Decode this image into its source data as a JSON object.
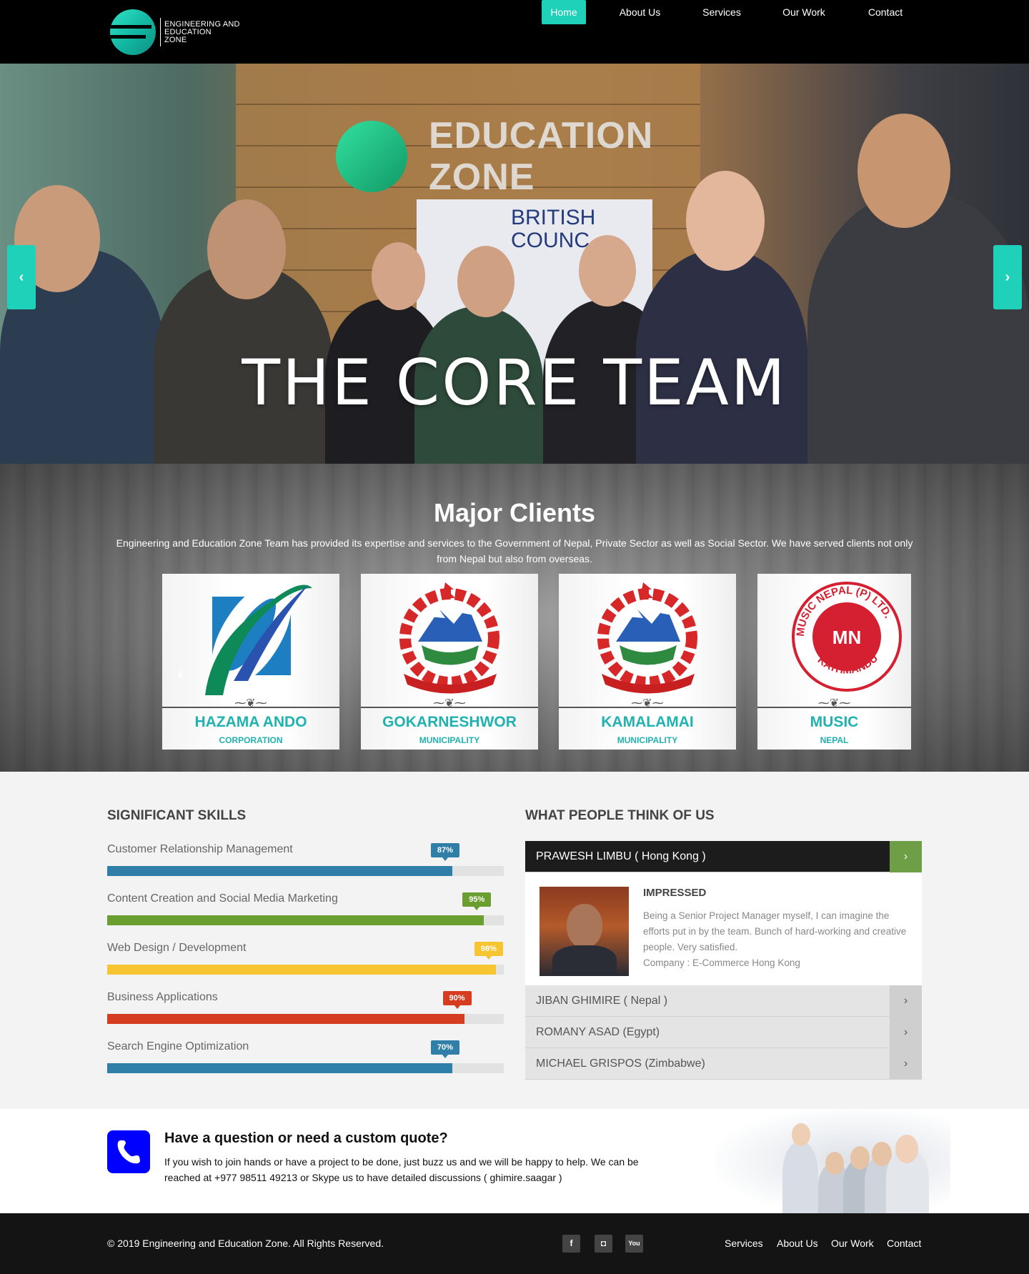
{
  "header": {
    "logo_text": [
      "ENGINEERING AND",
      "EDUCATION",
      "ZONE"
    ],
    "nav": [
      "Home",
      "About Us",
      "Services",
      "Our Work",
      "Contact"
    ],
    "accent": "#1fd1b9"
  },
  "hero": {
    "title": "THE CORE TEAM",
    "sign_text": [
      "EDUCATION",
      "ZONE"
    ],
    "banner_text": [
      "BRITISH",
      "COUNC"
    ],
    "prev_icon": "chevron-left-icon",
    "next_icon": "chevron-right-icon"
  },
  "clients": {
    "title": "Major Clients",
    "description": "Engineering and Education Zone Team has provided its expertise and services to the Government of Nepal, Private Sector as well as Social Sector. We have served clients not only from Nepal but also from overseas.",
    "items": [
      {
        "name": "HAZAMA ANDO",
        "sub": "CORPORATION"
      },
      {
        "name": "GOKARNESHWOR",
        "sub": "MUNICIPALITY"
      },
      {
        "name": "KAMALAMAI",
        "sub": "MUNICIPALITY"
      },
      {
        "name": "MUSIC",
        "sub": "NEPAL"
      }
    ],
    "music_logo": {
      "ring": "MUSIC NEPAL (P) LTD.",
      "bottom": "KATHMANDU",
      "center": "MN"
    }
  },
  "skills": {
    "title": "SIGNIFICANT SKILLS",
    "items": [
      {
        "label": "Customer Relationship Management",
        "badge": "87%",
        "value": 87,
        "color": "#2f7fa8"
      },
      {
        "label": "Content Creation and Social Media Marketing",
        "badge": "95%",
        "value": 95,
        "color": "#6a9e2f"
      },
      {
        "label": "Web Design / Development",
        "badge": "98%",
        "value": 98,
        "color": "#f7c531"
      },
      {
        "label": "Business Applications",
        "badge": "90%",
        "value": 90,
        "color": "#d63c1f"
      },
      {
        "label": "Search Engine Optimization",
        "badge": "70%",
        "value": 87,
        "color": "#2f7fa8"
      }
    ]
  },
  "testimonials": {
    "title": "WHAT PEOPLE THINK OF US",
    "items": [
      {
        "label": "PRAWESH LIMBU ( Hong Kong )",
        "open": true
      },
      {
        "label": "JIBAN GHIMIRE ( Nepal )",
        "open": false
      },
      {
        "label": "ROMANY ASAD (Egypt)",
        "open": false
      },
      {
        "label": "MICHAEL GRISPOS (Zimbabwe)",
        "open": false
      }
    ],
    "open_heading": "IMPRESSED",
    "open_text": "Being a Senior Project Manager myself, I can imagine the efforts put in by the team. Bunch of hard-working and creative people. Very satisfied.",
    "open_company": "Company : E-Commerce Hong Kong",
    "btn_icon": "chevron-right-icon"
  },
  "quote": {
    "title": "Have a question or need a custom quote?",
    "text": "If you wish to join hands or have a project to be done, just buzz us and we will be happy to help. We can be reached at +977 98511 49213 or Skype us to have detailed discussions ( ghimire.saagar )",
    "icon": "phone-icon"
  },
  "footer": {
    "copyright": "© 2019 Engineering and Education Zone. All Rights Reserved.",
    "social": [
      {
        "icon": "facebook-icon",
        "glyph": "f"
      },
      {
        "icon": "instagram-icon",
        "glyph": "◘"
      },
      {
        "icon": "youtube-icon",
        "glyph": "You"
      }
    ],
    "links": [
      "Services",
      "About Us",
      "Our Work",
      "Contact"
    ]
  }
}
